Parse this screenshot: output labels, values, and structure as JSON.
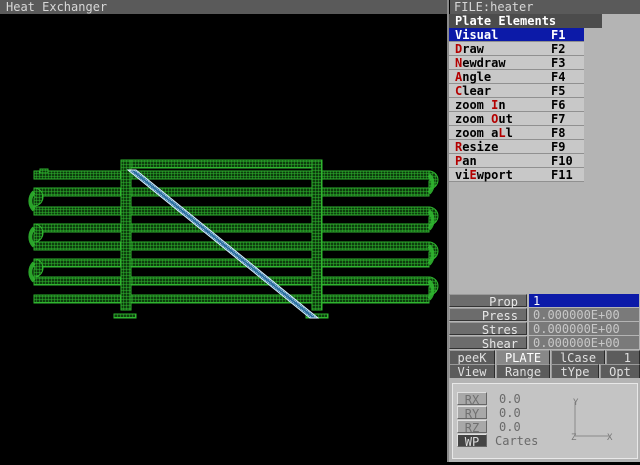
{
  "window": {
    "title": "Heat Exchanger",
    "file": "FILE:heater"
  },
  "menu": {
    "title": "Plate Elements",
    "items": [
      {
        "pre": "",
        "hot": "V",
        "post": "isual",
        "key": "F1",
        "selected": true
      },
      {
        "pre": "",
        "hot": "D",
        "post": "raw",
        "key": "F2"
      },
      {
        "pre": "",
        "hot": "N",
        "post": "ewdraw",
        "key": "F3"
      },
      {
        "pre": "",
        "hot": "A",
        "post": "ngle",
        "key": "F4"
      },
      {
        "pre": "",
        "hot": "C",
        "post": "lear",
        "key": "F5"
      },
      {
        "pre": "zoom ",
        "hot": "I",
        "post": "n",
        "key": "F6"
      },
      {
        "pre": "zoom ",
        "hot": "O",
        "post": "ut",
        "key": "F7"
      },
      {
        "pre": "zoom a",
        "hot": "L",
        "post": "l",
        "key": "F8"
      },
      {
        "pre": "",
        "hot": "R",
        "post": "esize",
        "key": "F9"
      },
      {
        "pre": "",
        "hot": "P",
        "post": "an",
        "key": "F10"
      },
      {
        "pre": "vi",
        "hot": "E",
        "post": "wport",
        "key": "F11"
      }
    ]
  },
  "properties": {
    "prop": {
      "label": "Prop",
      "value": "1"
    },
    "press": {
      "label": "Press",
      "value": "0.000000E+00"
    },
    "stres": {
      "label": "Stres",
      "value": "0.000000E+00"
    },
    "shear": {
      "label": "Shear",
      "value": "0.000000E+00"
    }
  },
  "tabs_row1": {
    "peek": "peeK",
    "plate": "PLATE",
    "lcase": "lCase",
    "lcase_value": "1"
  },
  "tabs_row2": {
    "view": "View",
    "range": "Range",
    "type": "tYpe",
    "opt": "Opt"
  },
  "rotation": {
    "rx_label": "RX",
    "rx": "0.0",
    "ry_label": "RY",
    "ry": "0.0",
    "rz_label": "RZ",
    "rz": "0.0",
    "wp_label": "WP",
    "wp": "Cartes"
  },
  "axes": {
    "y": "Y",
    "z": "Z",
    "x": "X"
  },
  "colors": {
    "mesh": "#2fb52f",
    "diagonal": "#d8f0ff",
    "selection": "#0c1aa8",
    "hotkey": "#b30000"
  }
}
